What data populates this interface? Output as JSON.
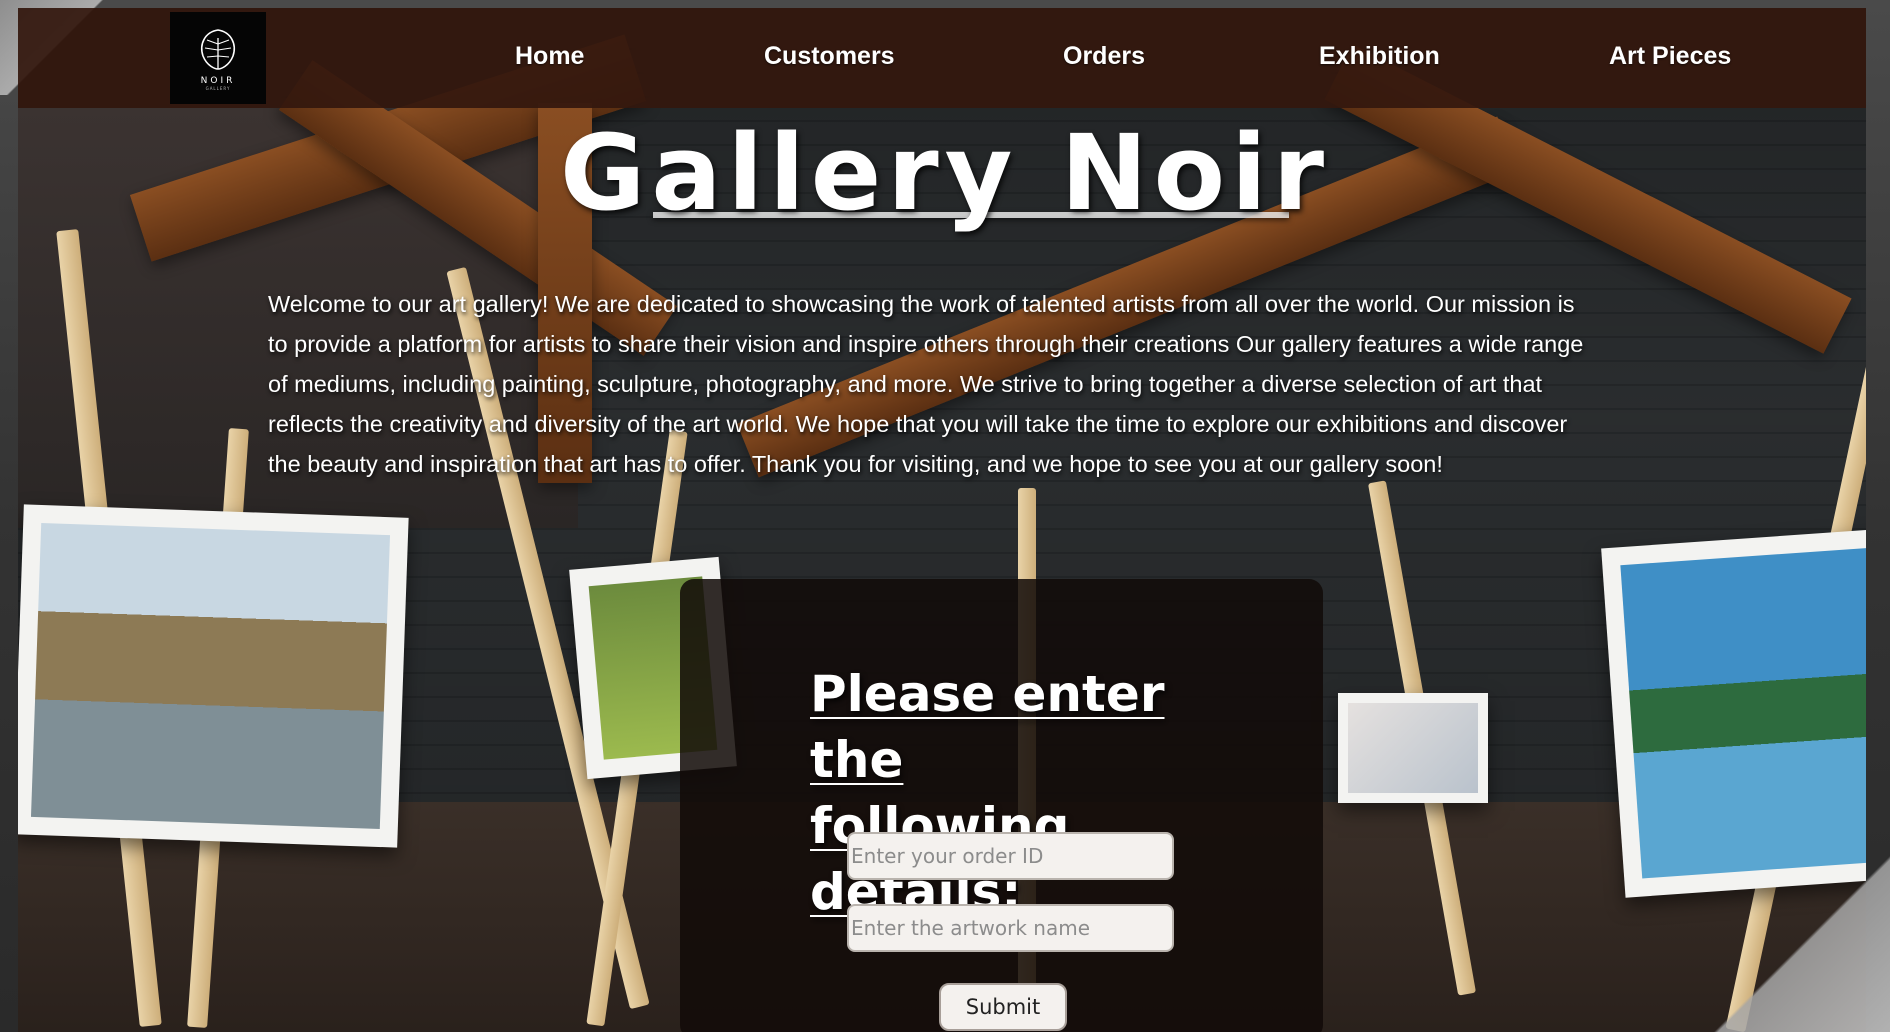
{
  "app": {
    "title": "Gallery Noir"
  },
  "logo": {
    "text": "NOIR",
    "subtext": "GALLERY"
  },
  "nav": {
    "items": [
      {
        "label": "Home"
      },
      {
        "label": "Customers"
      },
      {
        "label": "Orders"
      },
      {
        "label": "Exhibition"
      },
      {
        "label": "Art Pieces"
      }
    ]
  },
  "intro": {
    "text": "Welcome to our art gallery! We are dedicated to showcasing the work of talented artists from all over the world. Our mission is to provide a platform for artists to share their vision and inspire others through their creations Our gallery features a wide range of mediums, including painting, sculpture, photography, and more. We strive to bring together a diverse selection of art that reflects the creativity and diversity of the art world. We hope that you will take the time to explore our exhibitions and discover the beauty and inspiration that art has to offer. Thank you for visiting, and we hope to see you at our gallery soon!"
  },
  "form": {
    "heading_line1": "Please enter the",
    "heading_line2": "following details:",
    "order_id": {
      "placeholder": "Enter your order ID",
      "value": ""
    },
    "artwork_name": {
      "placeholder": "Enter the artwork name",
      "value": ""
    },
    "submit_label": "Submit"
  },
  "colors": {
    "navbar": "#34180e",
    "panel": "#120a08",
    "text": "#ffffff"
  },
  "icons": {
    "logo": "monstera-leaf-icon"
  }
}
